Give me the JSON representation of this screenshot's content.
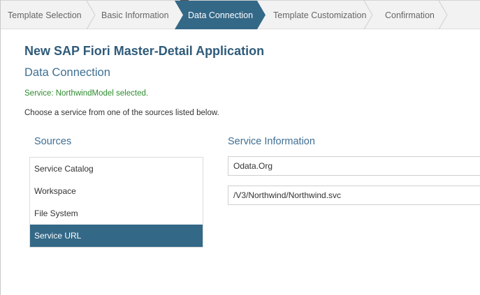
{
  "wizard": {
    "steps": [
      {
        "label": "Template Selection"
      },
      {
        "label": "Basic Information"
      },
      {
        "label": "Data Connection"
      },
      {
        "label": "Template Customization"
      },
      {
        "label": "Confirmation"
      }
    ],
    "active_index": 2
  },
  "header": {
    "app_title": "New SAP Fiori Master-Detail Application",
    "page_title": "Data Connection"
  },
  "status": {
    "message": "Service: NorthwindModel selected."
  },
  "instructions": "Choose a service from one of the sources listed below.",
  "sources": {
    "heading": "Sources",
    "items": [
      {
        "label": "Service Catalog"
      },
      {
        "label": "Workspace"
      },
      {
        "label": "File System"
      },
      {
        "label": "Service URL"
      }
    ],
    "selected_index": 3
  },
  "service_info": {
    "heading": "Service Information",
    "host_value": "Odata.Org",
    "path_value": "/V3/Northwind/Northwind.svc"
  },
  "colors": {
    "accent": "#346887",
    "success": "#2e8b2e",
    "heading": "#3f6f93"
  }
}
